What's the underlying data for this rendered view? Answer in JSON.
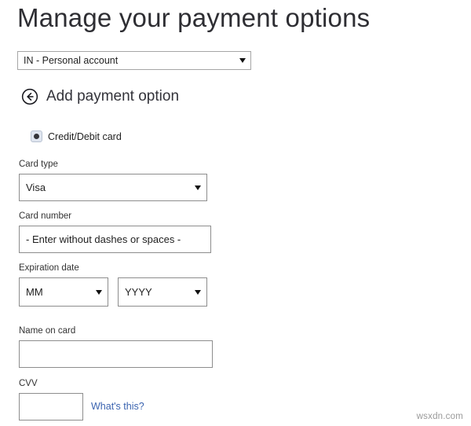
{
  "page": {
    "title": "Manage your payment options",
    "watermark": "wsxdn.com"
  },
  "account_selector": {
    "name": "account-select",
    "selected": "IN - Personal account",
    "icon": "chevron-down-icon"
  },
  "section": {
    "back_icon": "circle-back-arrow-icon",
    "heading": "Add payment option"
  },
  "payment_method": {
    "icon": "radio-selected-icon",
    "label": "Credit/Debit card",
    "selected": true
  },
  "form": {
    "card_type": {
      "label": "Card type",
      "selected": "Visa",
      "icon": "chevron-down-icon"
    },
    "card_number": {
      "label": "Card number",
      "value": "- Enter without dashes or spaces -",
      "placeholder": "- Enter without dashes or spaces -"
    },
    "expiration_date": {
      "label": "Expiration date",
      "month": {
        "selected": "MM",
        "icon": "chevron-down-icon"
      },
      "year": {
        "selected": "YYYY",
        "icon": "chevron-down-icon"
      }
    },
    "name_on_card": {
      "label": "Name on card",
      "value": "",
      "placeholder": ""
    },
    "cvv": {
      "label": "CVV",
      "value": "",
      "placeholder": "",
      "help_link": "What's this?"
    }
  },
  "colors": {
    "link_blue": "#3b64b0",
    "title_gray": "#2e2e33",
    "border_gray": "#8d8d8d",
    "radio_fill": "#dfe5ef"
  }
}
